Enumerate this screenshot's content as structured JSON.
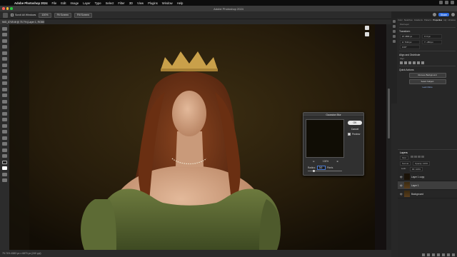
{
  "menubar": {
    "app": "Adobe Photoshop 2024",
    "items": [
      "File",
      "Edit",
      "Image",
      "Layer",
      "Type",
      "Select",
      "Filter",
      "3D",
      "View",
      "Plugins",
      "Window",
      "Help"
    ]
  },
  "window_title": "Adobe Photoshop 2024",
  "options": {
    "scroll_all": "Scroll All Windows",
    "zoom_pct": "100%",
    "fit_screen": "Fit Screen",
    "fill_screen": "Fill Screen"
  },
  "doc_tab": "IMG_8749.tif @ 75.7% (Layer 1, RGB/8*)",
  "status": "75.74%   4583 px x 6870 px (240 ppi)",
  "sidebar": {
    "share": "Share",
    "tabs": [
      "Color",
      "Swatches",
      "Gradients",
      "Patterns",
      "Properties",
      "Adj",
      "Libraries"
    ],
    "active_tab": "Properties",
    "pixel_layer": "Pixel Layer",
    "transform": "Transform",
    "w": "W: 4583 px",
    "h": "H: 7134 px",
    "x": "X: 0 px",
    "y": "Y: -263 px",
    "angle": "0.00°",
    "align_title": "Align and Distribute",
    "align_label": "Align:",
    "quick_title": "Quick Actions",
    "qa1": "Remove Background",
    "qa2": "Select Subject",
    "qa3": "Learn More"
  },
  "layers": {
    "title": "Layers",
    "kind": "Kind",
    "blend": "Normal",
    "opacity": "Opacity: 100%",
    "lock": "Lock:",
    "fill": "Fill: 100%",
    "items": [
      {
        "name": "Layer 1 copy"
      },
      {
        "name": "Layer 1"
      },
      {
        "name": "Background"
      }
    ]
  },
  "dialog": {
    "title": "Gaussian Blur",
    "ok": "OK",
    "cancel": "Cancel",
    "preview": "Preview",
    "zoom": "100%",
    "radius_label": "Radius:",
    "radius_value": "3.0",
    "units": "Pixels",
    "slider_level": 0.15
  },
  "colors": {
    "accent": "#2f6de1",
    "backdrop": "#2a2010",
    "dress": "#5d6b35",
    "hair": "#7a3a18",
    "crown": "#c9a04a"
  }
}
